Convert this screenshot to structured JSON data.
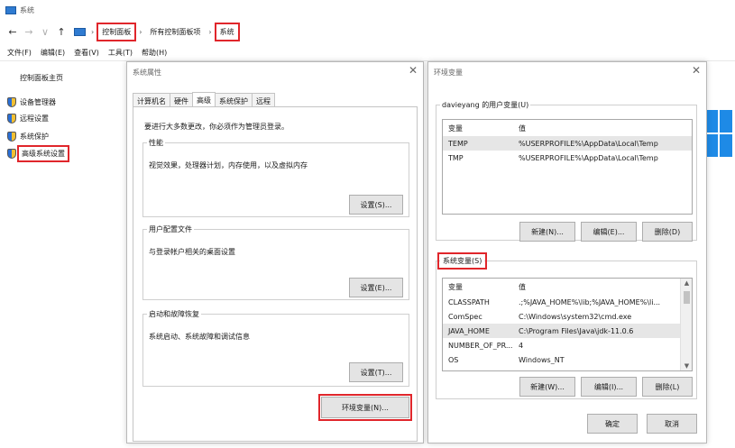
{
  "window": {
    "title": "系统",
    "nav": {
      "back": "←",
      "forward": "→",
      "recent": "∨",
      "up": "↑"
    },
    "breadcrumb": [
      "控制面板",
      "所有控制面板项",
      "系统"
    ],
    "menu": [
      "文件(F)",
      "编辑(E)",
      "查看(V)",
      "工具(T)",
      "帮助(H)"
    ],
    "sidebar": {
      "home": "控制面板主页",
      "items": [
        "设备管理器",
        "远程设置",
        "系统保护",
        "高级系统设置"
      ]
    }
  },
  "sysprops": {
    "title": "系统属性",
    "tabs": [
      "计算机名",
      "硬件",
      "高级",
      "系统保护",
      "远程"
    ],
    "notice": "要进行大多数更改，你必须作为管理员登录。",
    "perf": {
      "legend": "性能",
      "desc": "视觉效果，处理器计划，内存使用，以及虚拟内存",
      "button": "设置(S)..."
    },
    "profile": {
      "legend": "用户配置文件",
      "desc": "与登录帐户相关的桌面设置",
      "button": "设置(E)..."
    },
    "startup": {
      "legend": "启动和故障恢复",
      "desc": "系统启动、系统故障和调试信息",
      "button": "设置(T)..."
    },
    "envbutton": "环境变量(N)..."
  },
  "envvars": {
    "title": "环境变量",
    "user_legend": "davieyang 的用户变量(U)",
    "sys_legend": "系统变量(S)",
    "headers": {
      "var": "变量",
      "val": "值"
    },
    "user_vars": [
      {
        "var": "TEMP",
        "val": "%USERPROFILE%\\AppData\\Local\\Temp"
      },
      {
        "var": "TMP",
        "val": "%USERPROFILE%\\AppData\\Local\\Temp"
      }
    ],
    "sys_vars": [
      {
        "var": "CLASSPATH",
        "val": ".;%JAVA_HOME%\\lib;%JAVA_HOME%\\li..."
      },
      {
        "var": "ComSpec",
        "val": "C:\\Windows\\system32\\cmd.exe"
      },
      {
        "var": "JAVA_HOME",
        "val": "C:\\Program Files\\Java\\jdk-11.0.6"
      },
      {
        "var": "NUMBER_OF_PR...",
        "val": "4"
      },
      {
        "var": "OS",
        "val": "Windows_NT"
      }
    ],
    "user_buttons": {
      "new": "新建(N)...",
      "edit": "编辑(E)...",
      "delete": "删除(D)"
    },
    "sys_buttons": {
      "new": "新建(W)...",
      "edit": "编辑(I)...",
      "delete": "删除(L)"
    },
    "ok": "确定",
    "cancel": "取消"
  },
  "icons": {
    "close": "✕",
    "scroll_up": "▲",
    "scroll_down": "▼"
  },
  "colors": {
    "highlight": "#e0262b",
    "accent": "#2f7bd1",
    "win_logo": "#1e8ae6"
  }
}
